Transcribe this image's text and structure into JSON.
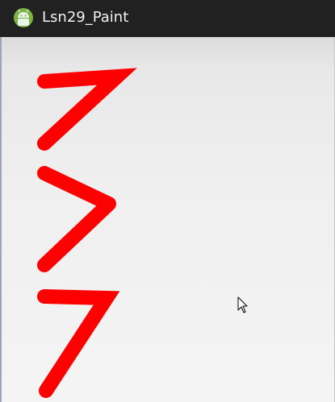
{
  "window": {
    "title": "Lsn29_Paint",
    "app_icon": "android-icon"
  },
  "canvas": {
    "stroke_color": "#ff0000",
    "strokes": [
      "stroke-1",
      "stroke-2",
      "stroke-3"
    ]
  },
  "pointer": {
    "icon": "mouse-cursor-icon"
  }
}
